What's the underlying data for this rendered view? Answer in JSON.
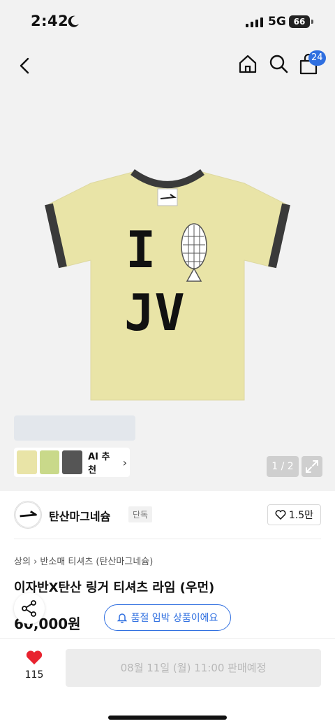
{
  "status_bar": {
    "time": "2:42",
    "network": "5G",
    "battery": "66"
  },
  "nav": {
    "cart_count": "24"
  },
  "gallery": {
    "ai_label": "AI 추천",
    "page_indicator": "1 / 2",
    "thumbnail_colors": [
      "#e9e4a7",
      "#c9d98a",
      "#555555"
    ]
  },
  "brand": {
    "name": "탄산마그네슘",
    "tag": "단독",
    "likes": "1.5만"
  },
  "product": {
    "breadcrumb": [
      "상의",
      "반소매 티셔츠 (탄산마그네슘)"
    ],
    "title": "이자반X탄산 링거 티셔츠 라임 (우먼)",
    "price": "60,000원",
    "soldout_label": "품절 임박 상품이에요"
  },
  "bottom": {
    "heart_count": "115",
    "buy_label": "08월 11일 (월) 11:00 판매예정"
  },
  "colors": {
    "accent": "#2f6fe0",
    "heart": "#e8232f",
    "shirt": "#e9e4a7",
    "trim": "#3a3a3a"
  },
  "shirt_print": {
    "line1": "I",
    "line2": "JV"
  }
}
